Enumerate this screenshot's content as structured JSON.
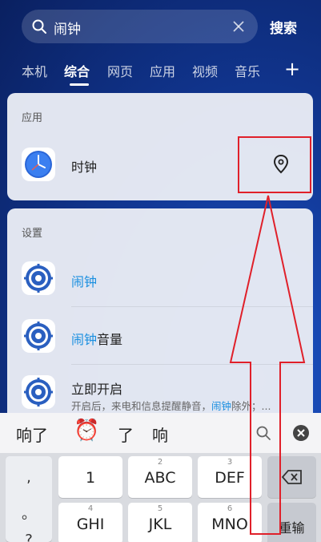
{
  "search": {
    "query": "闹钟",
    "button_label": "搜索"
  },
  "tabs": [
    {
      "label": "本机"
    },
    {
      "label": "综合",
      "active": true
    },
    {
      "label": "网页"
    },
    {
      "label": "应用"
    },
    {
      "label": "视频"
    },
    {
      "label": "音乐"
    }
  ],
  "add_tab_label": "+",
  "apps_section": {
    "title": "应用",
    "item": {
      "name": "时钟",
      "icon": "clock-icon",
      "action_icon": "location-pin-icon"
    }
  },
  "settings_section": {
    "title": "设置",
    "items": [
      {
        "prefix": "闹钟",
        "suffix": "",
        "icon": "settings-gear-icon"
      },
      {
        "prefix": "闹钟",
        "suffix": "音量",
        "icon": "settings-gear-icon"
      },
      {
        "label": "立即开启",
        "sub_before": "开启后，来电和信息提醒静音，",
        "sub_highlight": "闹钟",
        "sub_after": "除外；...",
        "icon": "settings-gear-icon"
      }
    ]
  },
  "suggestions": {
    "word1": "响了",
    "emoji": "⏰",
    "word2": "了",
    "word3": "响"
  },
  "keyboard": {
    "punct": [
      ",",
      "。",
      "?"
    ],
    "row1": [
      {
        "num": "",
        "label": "1"
      },
      {
        "num": "2",
        "label": "ABC"
      },
      {
        "num": "3",
        "label": "DEF"
      }
    ],
    "row2": [
      {
        "num": "4",
        "label": "GHI"
      },
      {
        "num": "5",
        "label": "JKL"
      },
      {
        "num": "6",
        "label": "MNO"
      }
    ],
    "backspace_icon": "backspace-icon",
    "reenter_label": "重输"
  },
  "colors": {
    "highlight": "#1a8fe0",
    "annotation": "#e0202a"
  }
}
